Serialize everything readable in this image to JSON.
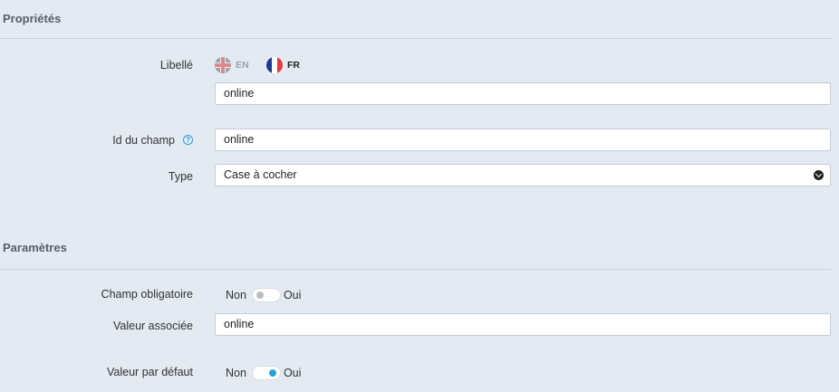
{
  "sections": {
    "properties": "Propriétés",
    "parameters": "Paramètres"
  },
  "libelle": {
    "label": "Libellé",
    "languages": [
      {
        "code": "EN",
        "active": false,
        "flag": "uk-flag-icon"
      },
      {
        "code": "FR",
        "active": true,
        "flag": "fr-flag-icon"
      }
    ],
    "value": "online"
  },
  "field_id": {
    "label": "Id du champ",
    "help_icon": "question-circle-icon",
    "value": "online"
  },
  "type": {
    "label": "Type",
    "selected": "Case à cocher",
    "icon": "chevron-down-circle-icon"
  },
  "required": {
    "label": "Champ obligatoire",
    "off_label": "Non",
    "on_label": "Oui",
    "state": "off"
  },
  "associated_value": {
    "label": "Valeur associée",
    "value": "online"
  },
  "default_value": {
    "label": "Valeur par défaut",
    "off_label": "Non",
    "on_label": "Oui",
    "state": "on"
  },
  "colors": {
    "background": "#e3eaf1",
    "accent": "#2ba0d8",
    "section_title": "#555f6b"
  }
}
